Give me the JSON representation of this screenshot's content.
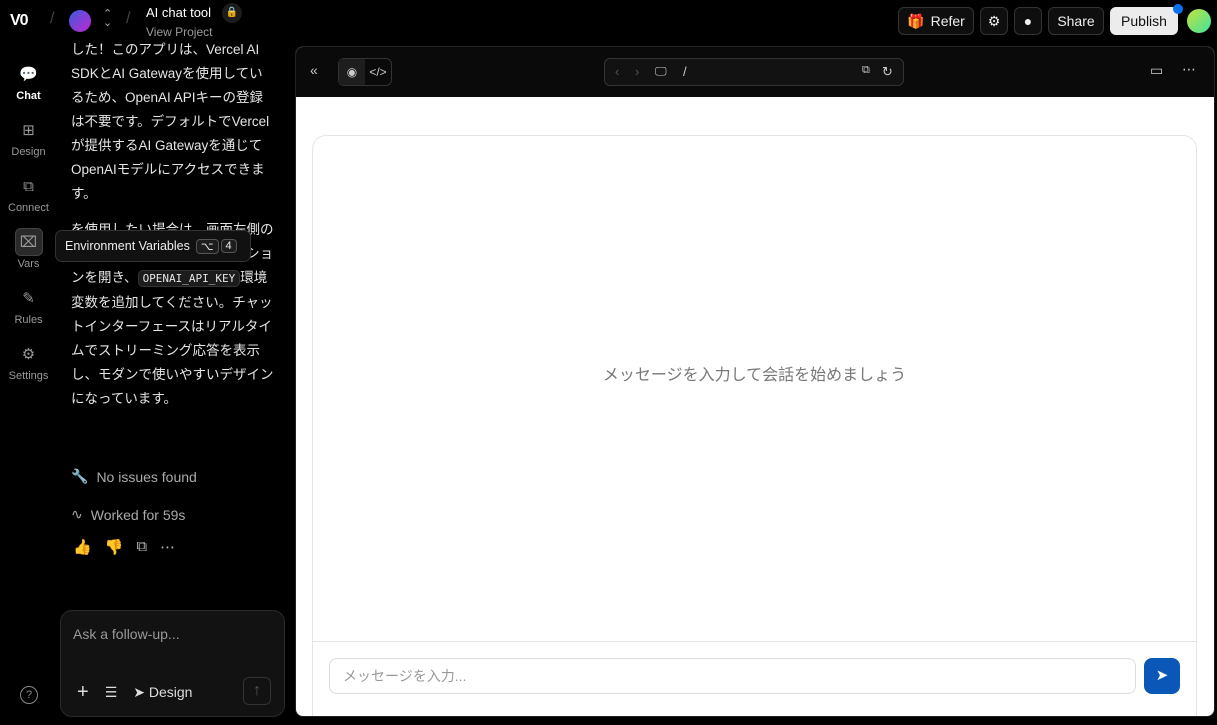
{
  "header": {
    "logo": "V0",
    "project_title": "AI chat tool",
    "project_sub": "View Project",
    "refer": "Refer",
    "share": "Share",
    "publish": "Publish"
  },
  "rail": [
    {
      "label": "Chat",
      "icon": "chat-icon"
    },
    {
      "label": "Design",
      "icon": "design-icon"
    },
    {
      "label": "Connect",
      "icon": "connect-icon"
    },
    {
      "label": "Vars",
      "icon": "vars-icon"
    },
    {
      "label": "Rules",
      "icon": "rules-icon"
    },
    {
      "label": "Settings",
      "icon": "gear-icon"
    }
  ],
  "chat": {
    "p1": "した！このアプリは、Vercel AI SDKとAI Gatewayを使用しているため、OpenAI APIキーの登録は不要です。デフォルトでVercelが提供するAI Gatewayを通じてOpenAIモデルにアクセスできます。",
    "p2a": "を使用したい場合は、画面左側のサイドバーから「Vars」セクションを開き、",
    "code": "OPENAI_API_KEY",
    "p2b": "環境変数を追加してください。チャットインターフェースはリアルタイムでストリーミング応答を表示し、モダンで使いやすいデザインになっています。",
    "issues": "No issues found",
    "worked": "Worked for 59s"
  },
  "tooltip": {
    "label": "Environment Variables",
    "key1": "⌥",
    "key2": "4"
  },
  "composer": {
    "placeholder": "Ask a follow-up...",
    "design": "Design"
  },
  "preview": {
    "path": "/",
    "empty": "メッセージを入力して会話を始めましょう",
    "input_placeholder": "メッセージを入力..."
  }
}
